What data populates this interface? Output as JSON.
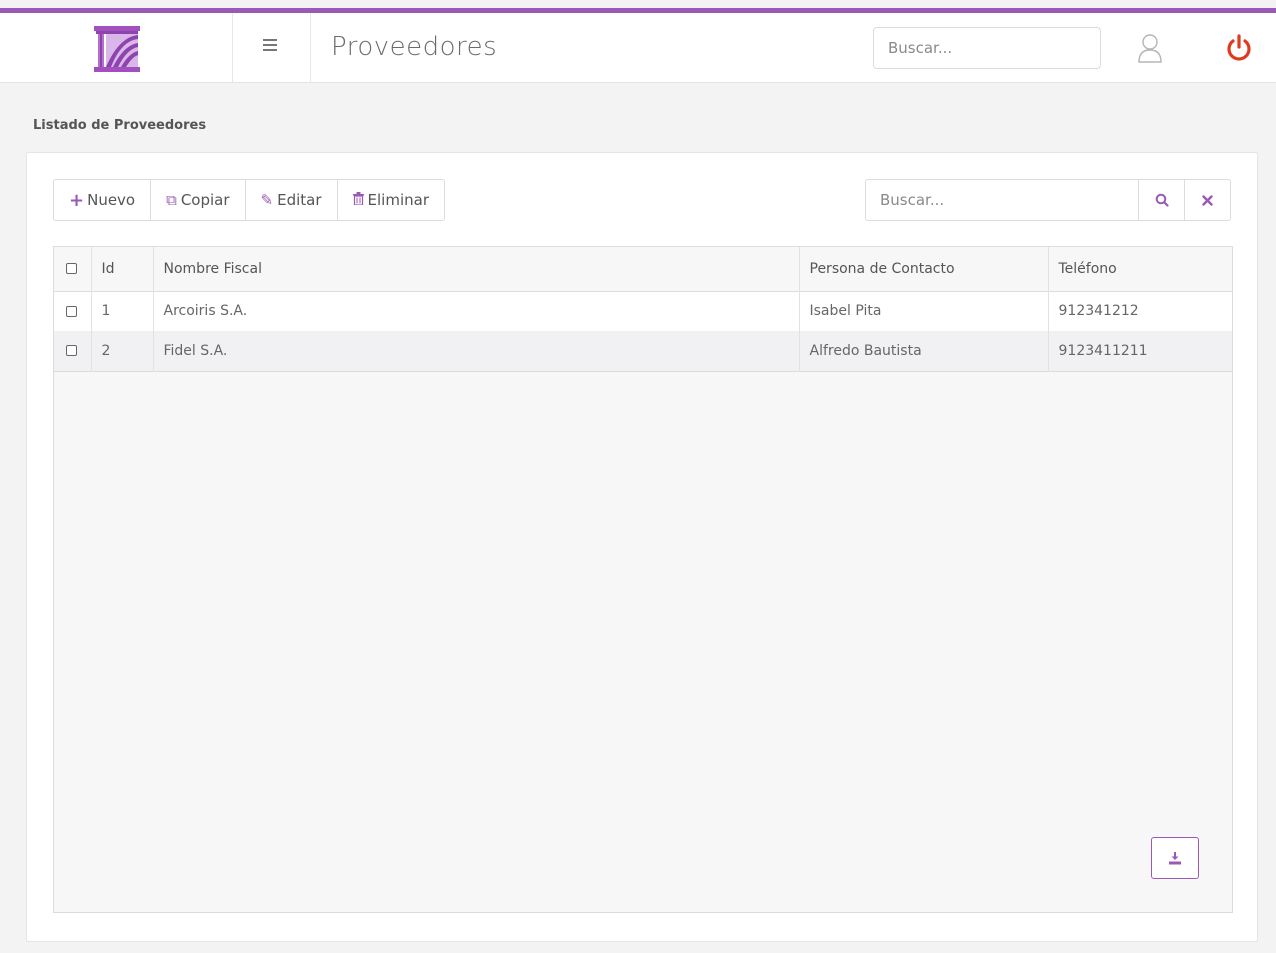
{
  "header": {
    "title": "Proveedores",
    "search_placeholder": "Buscar...",
    "accent_color": "#9b59b6",
    "power_color": "#e03a1e"
  },
  "page": {
    "section_title": "Listado de Proveedores"
  },
  "toolbar": {
    "buttons": [
      {
        "label": "Nuevo",
        "icon": "plus-icon"
      },
      {
        "label": "Copiar",
        "icon": "copy-icon"
      },
      {
        "label": "Editar",
        "icon": "edit-icon"
      },
      {
        "label": "Eliminar",
        "icon": "trash-icon"
      }
    ],
    "search_placeholder": "Buscar..."
  },
  "table": {
    "columns": [
      "Id",
      "Nombre Fiscal",
      "Persona de Contacto",
      "Teléfono"
    ],
    "rows": [
      {
        "id": "1",
        "name": "Arcoiris S.A.",
        "contact": "Isabel Pita",
        "phone": "912341212"
      },
      {
        "id": "2",
        "name": "Fidel S.A.",
        "contact": "Alfredo Bautista",
        "phone": "9123411211"
      }
    ]
  }
}
